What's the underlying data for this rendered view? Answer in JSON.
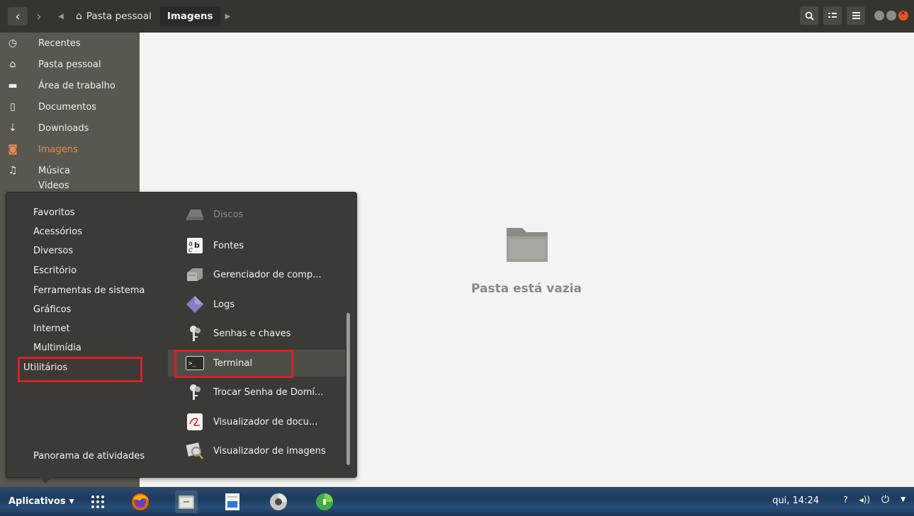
{
  "header": {
    "breadcrumbs": [
      {
        "label": "Pasta pessoal",
        "icon": "home-icon"
      },
      {
        "label": "Imagens"
      }
    ],
    "buttons": [
      "search-icon",
      "view-toggle-icon",
      "menu-icon"
    ]
  },
  "sidebar": {
    "items": [
      {
        "label": "Recentes",
        "icon": "clock-icon"
      },
      {
        "label": "Pasta pessoal",
        "icon": "home-icon"
      },
      {
        "label": "Área de trabalho",
        "icon": "folder-icon"
      },
      {
        "label": "Documentos",
        "icon": "document-icon"
      },
      {
        "label": "Downloads",
        "icon": "download-icon"
      },
      {
        "label": "Imagens",
        "icon": "camera-icon",
        "active": true
      },
      {
        "label": "Música",
        "icon": "music-icon"
      },
      {
        "label": "Vídeos",
        "icon": "video-icon"
      }
    ]
  },
  "main": {
    "empty_label": "Pasta está vazia"
  },
  "app_menu": {
    "categories": [
      "Favoritos",
      "Acessórios",
      "Diversos",
      "Escritório",
      "Ferramentas de sistema",
      "Gráficos",
      "Internet",
      "Multimídia",
      "Utilitários"
    ],
    "overview": "Panorama de atividades",
    "apps": [
      {
        "label": "Discos",
        "icon": "disks-icon",
        "dim": true
      },
      {
        "label": "Fontes",
        "icon": "fonts-icon"
      },
      {
        "label": "Gerenciador de comp...",
        "icon": "archive-manager-icon"
      },
      {
        "label": "Logs",
        "icon": "logs-icon"
      },
      {
        "label": "Senhas e chaves",
        "icon": "keys-icon"
      },
      {
        "label": "Terminal",
        "icon": "terminal-icon",
        "selected": true
      },
      {
        "label": "Trocar Senha de Domí...",
        "icon": "keys-icon"
      },
      {
        "label": "Visualizador de docu...",
        "icon": "document-viewer-icon"
      },
      {
        "label": "Visualizador de imagens",
        "icon": "image-viewer-icon"
      }
    ],
    "highlight_color": "#d6212a"
  },
  "panel": {
    "apps_label": "Aplicativos",
    "clock": "qui, 14:24",
    "tray": [
      "network-icon",
      "volume-icon",
      "power-icon"
    ],
    "taskbar": [
      "firefox-icon",
      "files-icon",
      "text-editor-icon",
      "chrome-icon",
      "green-app-icon"
    ]
  },
  "colors": {
    "accent": "#e98b4d",
    "header_bg": "#353530",
    "sidebar_bg": "#585850",
    "menu_bg": "#3b3a36"
  }
}
